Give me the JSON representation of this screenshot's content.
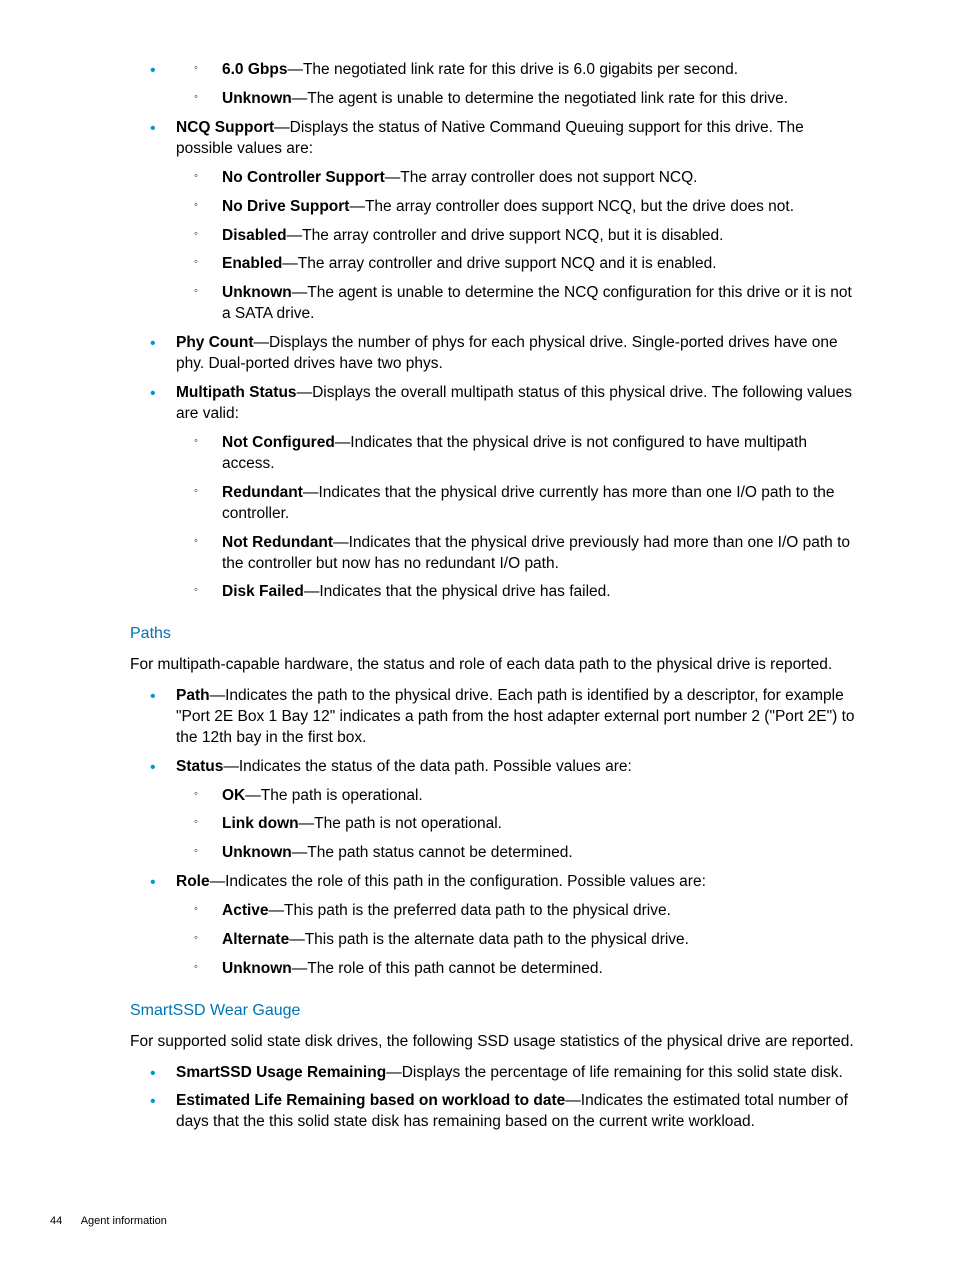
{
  "continued": {
    "items": [
      {
        "term": "6.0 Gbps",
        "desc": "—The negotiated link rate for this drive is 6.0 gigabits per second."
      },
      {
        "term": "Unknown",
        "desc": "—The agent is unable to determine the negotiated link rate for this drive."
      }
    ]
  },
  "ncq": {
    "term": "NCQ Support",
    "desc": "—Displays the status of Native Command Queuing support for this drive. The possible values are:",
    "items": [
      {
        "term": "No Controller Support",
        "desc": "—The array controller does not support NCQ."
      },
      {
        "term": "No Drive Support",
        "desc": "—The array controller does support NCQ, but the drive does not."
      },
      {
        "term": "Disabled",
        "desc": "—The array controller and drive support NCQ, but it is disabled."
      },
      {
        "term": "Enabled",
        "desc": "—The array controller and drive support NCQ and it is enabled."
      },
      {
        "term": "Unknown",
        "desc": "—The agent is unable to determine the NCQ configuration for this drive or it is not a SATA drive."
      }
    ]
  },
  "phy": {
    "term": "Phy Count",
    "desc": "—Displays the number of phys for each physical drive. Single-ported drives have one phy. Dual-ported drives have two phys."
  },
  "multipath": {
    "term": "Multipath Status",
    "desc": "—Displays the overall multipath status of this physical drive. The following values are valid:",
    "items": [
      {
        "term": "Not Configured",
        "desc": "—Indicates that the physical drive is not configured to have multipath access."
      },
      {
        "term": "Redundant",
        "desc": "—Indicates that the physical drive currently has more than one I/O path to the controller."
      },
      {
        "term": "Not Redundant",
        "desc": "—Indicates that the physical drive previously had more than one I/O path to the controller but now has no redundant I/O path."
      },
      {
        "term": "Disk Failed",
        "desc": "—Indicates that the physical drive has failed."
      }
    ]
  },
  "paths": {
    "heading": "Paths",
    "intro": "For multipath-capable hardware, the status and role of each data path to the physical drive is reported.",
    "path": {
      "term": "Path",
      "desc": "—Indicates the path to the physical drive. Each path is identified by a descriptor, for example \"Port 2E Box 1 Bay 12\" indicates a path from the host adapter external port number 2 (\"Port 2E\") to the 12th bay in the first box."
    },
    "status": {
      "term": "Status",
      "desc": "—Indicates the status of the data path. Possible values are:",
      "items": [
        {
          "term": "OK",
          "desc": "—The path is operational."
        },
        {
          "term": "Link down",
          "desc": "—The path is not operational."
        },
        {
          "term": "Unknown",
          "desc": "—The path status cannot be determined."
        }
      ]
    },
    "role": {
      "term": "Role",
      "desc": "—Indicates the role of this path in the configuration. Possible values are:",
      "items": [
        {
          "term": "Active",
          "desc": "—This path is the preferred data path to the physical drive."
        },
        {
          "term": "Alternate",
          "desc": "—This path is the alternate data path to the physical drive."
        },
        {
          "term": "Unknown",
          "desc": "—The role of this path cannot be determined."
        }
      ]
    }
  },
  "smartssd": {
    "heading": "SmartSSD Wear Gauge",
    "intro": "For supported solid state disk drives, the following SSD usage statistics of the physical drive are reported.",
    "items": [
      {
        "term": "SmartSSD Usage Remaining",
        "desc": "—Displays the percentage of life remaining for this solid state disk."
      },
      {
        "term": "Estimated Life Remaining based on workload to date",
        "desc": "—Indicates the estimated total number of days that the this solid state disk has remaining based on the current write workload."
      }
    ]
  },
  "footer": {
    "page": "44",
    "label": "Agent information"
  }
}
